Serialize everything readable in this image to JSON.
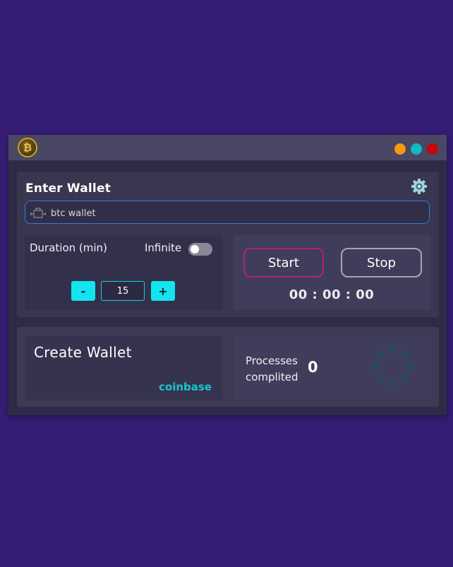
{
  "colors": {
    "background": "#351c74",
    "accent": "#12e5f0",
    "start_border": "#b0256e",
    "input_border": "#2f7fe0",
    "link": "#19c6cf"
  },
  "titlebar": {
    "logo_icon": "bitcoin-icon",
    "logo_glyph": "₿",
    "controls": [
      "minimize",
      "maximize",
      "close"
    ]
  },
  "wallet": {
    "title": "Enter Wallet",
    "settings_icon": "gear-icon",
    "input_icon": "wallet-icon",
    "input_value": "btc wallet"
  },
  "duration": {
    "label": "Duration (min)",
    "infinite_label": "Infinite",
    "infinite_enabled": false,
    "minus_label": "-",
    "plus_label": "+",
    "value": "15"
  },
  "controls": {
    "start_label": "Start",
    "stop_label": "Stop",
    "timer": "00 : 00 : 00"
  },
  "create": {
    "title": "Create Wallet",
    "link_label": "coinbase"
  },
  "processes": {
    "label_line1": "Processes",
    "label_line2": "complited",
    "count": "0",
    "spinner_icon": "loading-spinner-icon"
  }
}
